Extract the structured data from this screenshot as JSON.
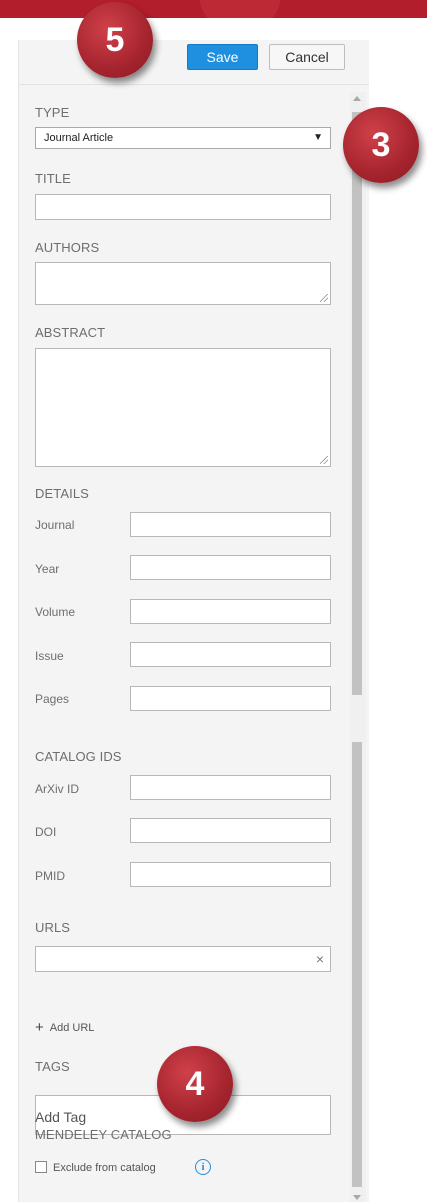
{
  "toolbar": {
    "save_label": "Save",
    "cancel_label": "Cancel"
  },
  "type_section": {
    "label": "TYPE",
    "selected": "Journal Article",
    "arrow": "▼"
  },
  "title_section": {
    "label": "TITLE",
    "value": ""
  },
  "authors_section": {
    "label": "AUTHORS",
    "value": ""
  },
  "abstract_section": {
    "label": "ABSTRACT",
    "value": ""
  },
  "details": {
    "label": "DETAILS",
    "fields": [
      {
        "label": "Journal",
        "value": ""
      },
      {
        "label": "Year",
        "value": ""
      },
      {
        "label": "Volume",
        "value": ""
      },
      {
        "label": "Issue",
        "value": ""
      },
      {
        "label": "Pages",
        "value": ""
      }
    ]
  },
  "catalog_ids": {
    "label": "CATALOG IDS",
    "fields": [
      {
        "label": "ArXiv ID",
        "value": ""
      },
      {
        "label": "DOI",
        "value": ""
      },
      {
        "label": "PMID",
        "value": ""
      }
    ]
  },
  "urls": {
    "label": "URLS",
    "value": "",
    "clear_icon": "×",
    "add_url_label": "Add URL",
    "add_icon": "+"
  },
  "tags": {
    "label": "TAGS",
    "placeholder": "Add Tag"
  },
  "mendeley_catalog": {
    "label": "MENDELEY CATALOG",
    "exclude_label": "Exclude from catalog",
    "exclude_checked": false,
    "info_icon": "i"
  },
  "badges": [
    {
      "number": "5"
    },
    {
      "number": "3"
    },
    {
      "number": "4"
    }
  ],
  "colors": {
    "accent": "#1f8fe0",
    "badge": "#a5242e",
    "topbar": "#b21e2b",
    "panel_bg": "#f4f4f4"
  }
}
